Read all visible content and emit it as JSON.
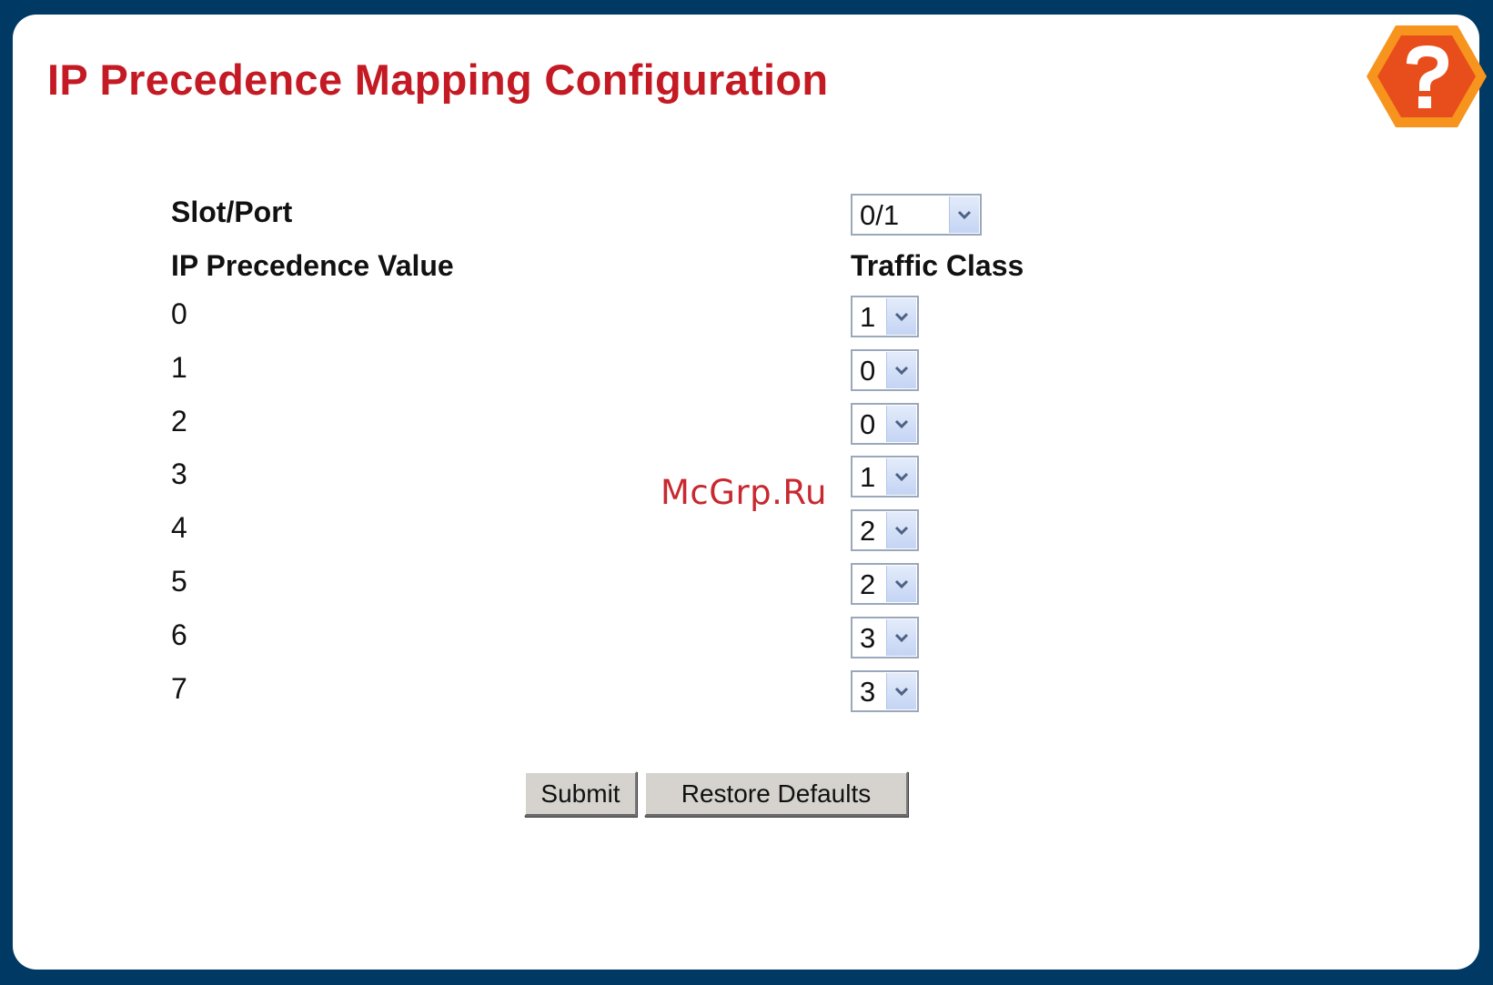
{
  "page": {
    "title": "IP Precedence Mapping Configuration"
  },
  "help": {
    "icon": "help-question-icon",
    "colors": {
      "outer": "#f7941d",
      "inner": "#e84e1b",
      "glyph": "#ffffff"
    }
  },
  "form": {
    "slot_port_label": "Slot/Port",
    "slot_port_value": "0/1",
    "precedence_header": "IP Precedence Value",
    "traffic_class_header": "Traffic Class",
    "rows": [
      {
        "precedence": "0",
        "traffic_class": "1"
      },
      {
        "precedence": "1",
        "traffic_class": "0"
      },
      {
        "precedence": "2",
        "traffic_class": "0"
      },
      {
        "precedence": "3",
        "traffic_class": "1"
      },
      {
        "precedence": "4",
        "traffic_class": "2"
      },
      {
        "precedence": "5",
        "traffic_class": "2"
      },
      {
        "precedence": "6",
        "traffic_class": "3"
      },
      {
        "precedence": "7",
        "traffic_class": "3"
      }
    ]
  },
  "buttons": {
    "submit": "Submit",
    "restore": "Restore Defaults"
  },
  "watermark": "McGrp.Ru",
  "colors": {
    "frame": "#003a64",
    "title": "#c41a24",
    "button_face": "#d6d3ce"
  }
}
